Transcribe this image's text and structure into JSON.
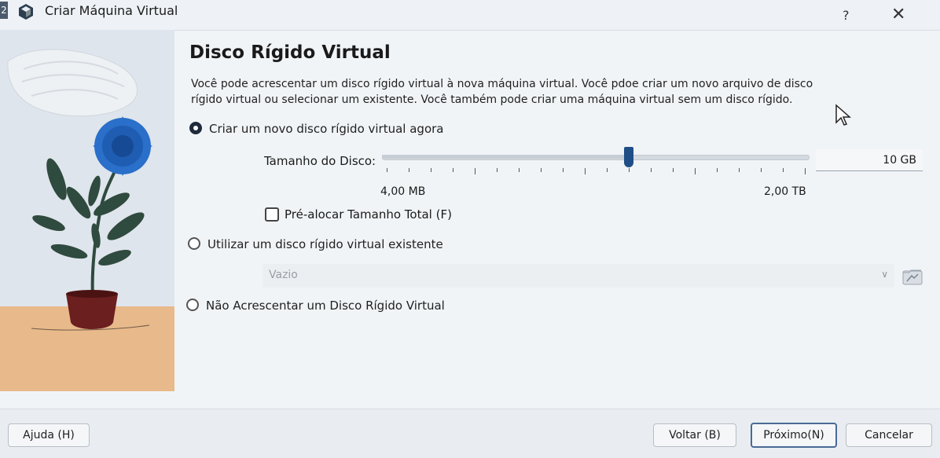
{
  "window": {
    "edge_number": "2",
    "title": "Criar Máquina Virtual",
    "help_label": "?",
    "close_glyph": "✕"
  },
  "page": {
    "heading": "Disco Rígido Virtual",
    "description_line1": "Você pode acrescentar um disco rígido virtual à nova máquina virtual. Você pdoe criar um novo arquivo de disco",
    "description_line2": "rígido virtual ou selecionar um existente. Você também pode criar uma máquina virtual sem um disco rígido."
  },
  "options": {
    "create_new": {
      "label": "Criar um novo disco rígido virtual agora",
      "checked": true
    },
    "use_existing": {
      "label": "Utilizar um disco rígido virtual existente",
      "checked": false
    },
    "no_disk": {
      "label": "Não Acrescentar um Disco Rígido Virtual",
      "checked": false
    }
  },
  "disk_size": {
    "label": "Tamanho do Disco:",
    "value": "10 GB",
    "min_label": "4,00 MB",
    "max_label": "2,00 TB",
    "slider_fraction": 0.58
  },
  "preallocate": {
    "label": "Pré-alocar Tamanho Total (F)",
    "checked": false
  },
  "existing_disk_combo": {
    "value": "Vazio"
  },
  "footer": {
    "help_button": "Ajuda (H)",
    "back_button": "Voltar (B)",
    "next_button": "Próximo(N)",
    "cancel_button": "Cancelar"
  },
  "colors": {
    "accent": "#1f4e86",
    "flower": "#2a6fc9",
    "leaves": "#2f4a3e",
    "pot": "#6b1f1f",
    "table": "#e8b98a"
  },
  "icons": [
    "app-icon",
    "close-icon",
    "folder-icon",
    "chevron-down-icon",
    "mouse-cursor-icon"
  ]
}
